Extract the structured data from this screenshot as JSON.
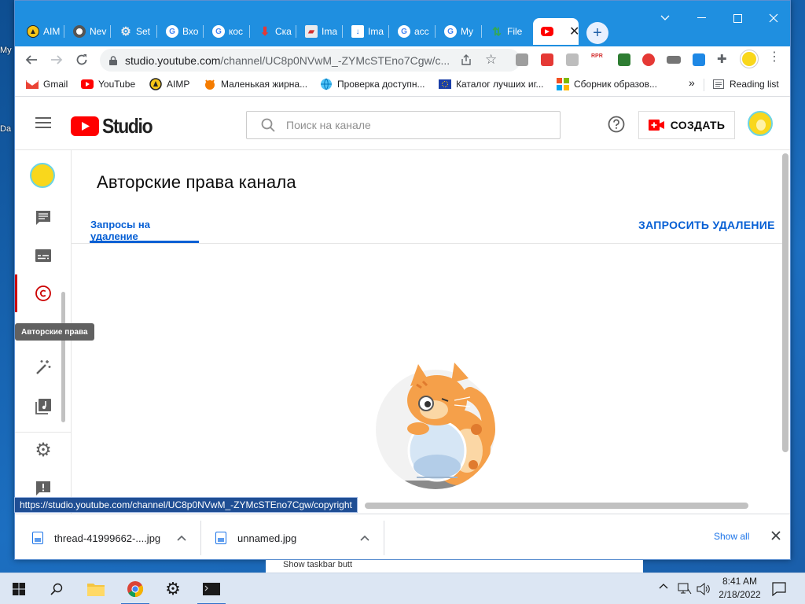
{
  "desktop": {
    "icon_labels": [
      "My",
      "Da"
    ],
    "behind_window_text": "Show taskbar butt"
  },
  "browser": {
    "tabs": [
      {
        "label": "AIM",
        "icon": "aimp-icon"
      },
      {
        "label": "Nev",
        "icon": "chrome-icon"
      },
      {
        "label": "Set",
        "icon": "gear-icon"
      },
      {
        "label": "Вхо",
        "icon": "google-icon"
      },
      {
        "label": "кос",
        "icon": "google-icon"
      },
      {
        "label": "Ска",
        "icon": "download-arrow-icon"
      },
      {
        "label": "Ima",
        "icon": "image-icon"
      },
      {
        "label": "Ima",
        "icon": "download-icon"
      },
      {
        "label": "acc",
        "icon": "google-icon"
      },
      {
        "label": "My",
        "icon": "google-icon"
      },
      {
        "label": "File",
        "icon": "arrows-icon"
      },
      {
        "label": "",
        "icon": "youtube-icon",
        "active": true
      }
    ],
    "url_host": "studio.youtube.com",
    "url_path": "/channel/UC8p0NVwM_-ZYMcSTEno7Cgw/c...",
    "bookmarks": [
      {
        "label": "Gmail",
        "icon": "gmail-icon"
      },
      {
        "label": "YouTube",
        "icon": "youtube-icon"
      },
      {
        "label": "AIMP",
        "icon": "aimp-icon"
      },
      {
        "label": "Маленькая жирна...",
        "icon": "fox-icon"
      },
      {
        "label": "Проверка доступн...",
        "icon": "globe-icon"
      },
      {
        "label": "Каталог лучших иг...",
        "icon": "eu-flag-icon"
      },
      {
        "label": "Сборник образов...",
        "icon": "ms-icon"
      }
    ],
    "bookmarks_more": "»",
    "reading_list": "Reading list",
    "status_url": "https://studio.youtube.com/channel/UC8p0NVwM_-ZYMcSTEno7Cgw/copyright"
  },
  "studio": {
    "logo_text": "Studio",
    "search_placeholder": "Поиск на канале",
    "create_label": "СОЗДАТЬ",
    "page_title": "Авторские права канала",
    "tab_label": "Запросы на удаление",
    "request_button": "ЗАПРОСИТЬ УДАЛЕНИЕ",
    "tooltip": "Авторские права",
    "accent_color": "#065fd4",
    "brand_color": "#ff0000"
  },
  "downloads": {
    "items": [
      {
        "name": "thread-41999662-....jpg"
      },
      {
        "name": "unnamed.jpg"
      }
    ],
    "show_all": "Show all"
  },
  "taskbar": {
    "time": "8:41 AM",
    "date": "2/18/2022"
  }
}
